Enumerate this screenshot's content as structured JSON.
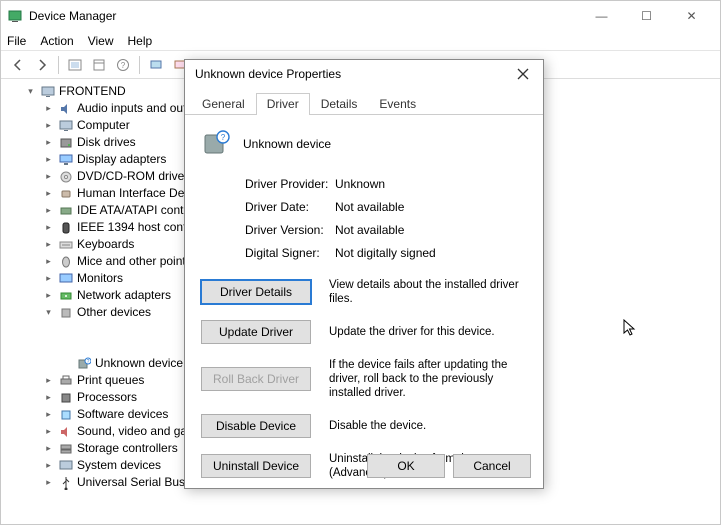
{
  "window": {
    "title": "Device Manager",
    "controls": {
      "min": "—",
      "max": "☐",
      "close": "✕"
    }
  },
  "menu": {
    "file": "File",
    "action": "Action",
    "view": "View",
    "help": "Help"
  },
  "tree": {
    "root": "FRONTEND",
    "items": [
      "Audio inputs and outputs",
      "Computer",
      "Disk drives",
      "Display adapters",
      "DVD/CD-ROM drives",
      "Human Interface Devices",
      "IDE ATA/ATAPI controllers",
      "IEEE 1394 host controllers",
      "Keyboards",
      "Mice and other pointing devices",
      "Monitors",
      "Network adapters"
    ],
    "other": {
      "label": "Other devices",
      "unknown": "Unknown device"
    },
    "items2": [
      "Print queues",
      "Processors",
      "Software devices",
      "Sound, video and game controllers",
      "Storage controllers",
      "System devices",
      "Universal Serial Bus controllers"
    ]
  },
  "dialog": {
    "title": "Unknown device Properties",
    "tabs": {
      "general": "General",
      "driver": "Driver",
      "details": "Details",
      "events": "Events"
    },
    "device_name": "Unknown device",
    "info": {
      "provider_k": "Driver Provider:",
      "provider_v": "Unknown",
      "date_k": "Driver Date:",
      "date_v": "Not available",
      "version_k": "Driver Version:",
      "version_v": "Not available",
      "signer_k": "Digital Signer:",
      "signer_v": "Not digitally signed"
    },
    "actions": {
      "details": {
        "btn": "Driver Details",
        "desc": "View details about the installed driver files."
      },
      "update": {
        "btn": "Update Driver",
        "desc": "Update the driver for this device."
      },
      "rollback": {
        "btn": "Roll Back Driver",
        "desc": "If the device fails after updating the driver, roll back to the previously installed driver."
      },
      "disable": {
        "btn": "Disable Device",
        "desc": "Disable the device."
      },
      "uninstall": {
        "btn": "Uninstall Device",
        "desc": "Uninstall the device from the system (Advanced)."
      }
    },
    "footer": {
      "ok": "OK",
      "cancel": "Cancel"
    }
  }
}
